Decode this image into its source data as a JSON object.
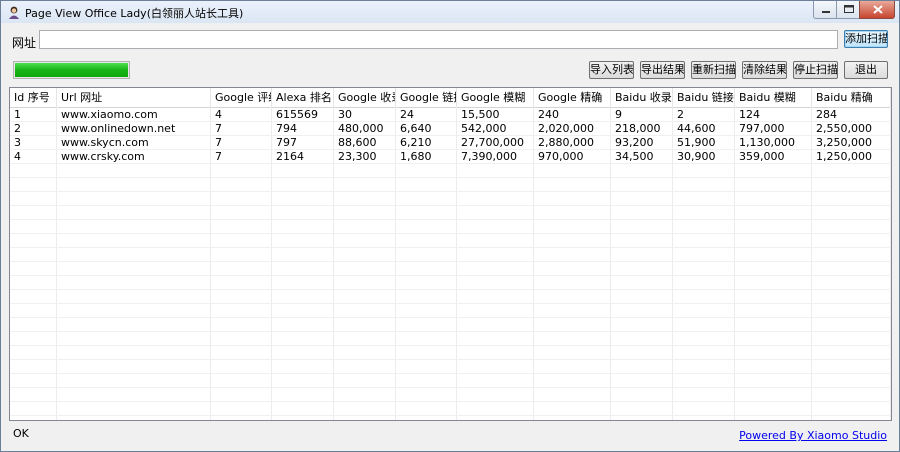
{
  "window": {
    "title": "Page View Office Lady(白领丽人站长工具)"
  },
  "url_bar": {
    "label": "网址",
    "value": "",
    "add_button": "添加扫描"
  },
  "progress": {
    "fraction": 1.0
  },
  "toolbar": {
    "import": "导入列表",
    "export": "导出结果",
    "rescan": "重新扫描",
    "clear": "清除结果",
    "stop": "停止扫描",
    "exit": "退出"
  },
  "table": {
    "columns": [
      "Id 序号",
      "Url 网址",
      "Google 评级",
      "Alexa 排名",
      "Google 收录",
      "Google 链接",
      "Google 模糊",
      "Google 精确",
      "Baidu 收录",
      "Baidu 链接",
      "Baidu 模糊",
      "Baidu 精确"
    ],
    "rows": [
      [
        "1",
        "www.xiaomo.com",
        "4",
        "615569",
        "30",
        "24",
        "15,500",
        "240",
        "9",
        "2",
        "124",
        "284"
      ],
      [
        "2",
        "www.onlinedown.net",
        "7",
        "794",
        "480,000",
        "6,640",
        "542,000",
        "2,020,000",
        "218,000",
        "44,600",
        "797,000",
        "2,550,000"
      ],
      [
        "3",
        "www.skycn.com",
        "7",
        "797",
        "88,600",
        "6,210",
        "27,700,000",
        "2,880,000",
        "93,200",
        "51,900",
        "1,130,000",
        "3,250,000"
      ],
      [
        "4",
        "www.crsky.com",
        "7",
        "2164",
        "23,300",
        "1,680",
        "7,390,000",
        "970,000",
        "34,500",
        "30,900",
        "359,000",
        "1,250,000"
      ]
    ]
  },
  "status": {
    "text": "OK",
    "powered_by": "Powered By Xiaomo Studio"
  },
  "colors": {
    "progress": "#18b418",
    "link": "#0000ee"
  }
}
